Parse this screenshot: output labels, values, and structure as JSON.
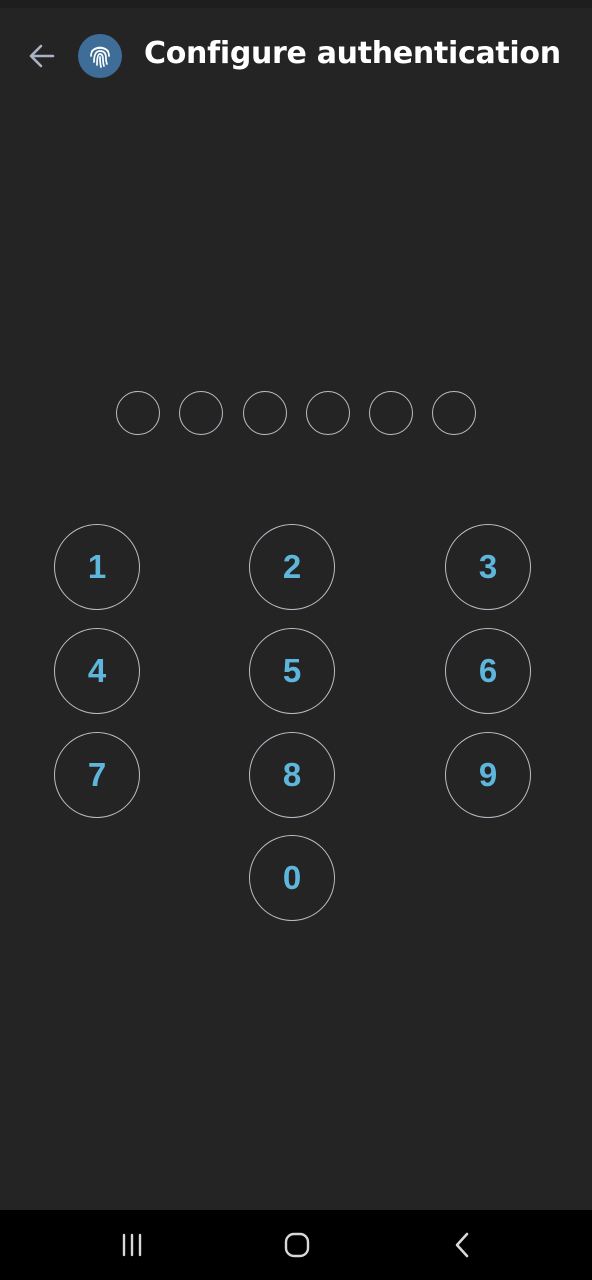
{
  "header": {
    "title": "Configure authentication",
    "back_icon": "arrow-left-icon",
    "logo_icon": "fingerprint-icon"
  },
  "pin": {
    "length": 6,
    "entered": 0
  },
  "keypad": {
    "keys": [
      {
        "label": "1"
      },
      {
        "label": "2"
      },
      {
        "label": "3"
      },
      {
        "label": "4"
      },
      {
        "label": "5"
      },
      {
        "label": "6"
      },
      {
        "label": "7"
      },
      {
        "label": "8"
      },
      {
        "label": "9"
      },
      {
        "label": "0"
      }
    ]
  },
  "navbar": {
    "recents_icon": "recent-apps-icon",
    "home_icon": "home-icon",
    "back_icon": "back-chevron-icon"
  },
  "colors": {
    "background": "#242424",
    "accent": "#5eb6dc",
    "outline": "#b9bec7",
    "logo_bg": "#3e6e98"
  }
}
